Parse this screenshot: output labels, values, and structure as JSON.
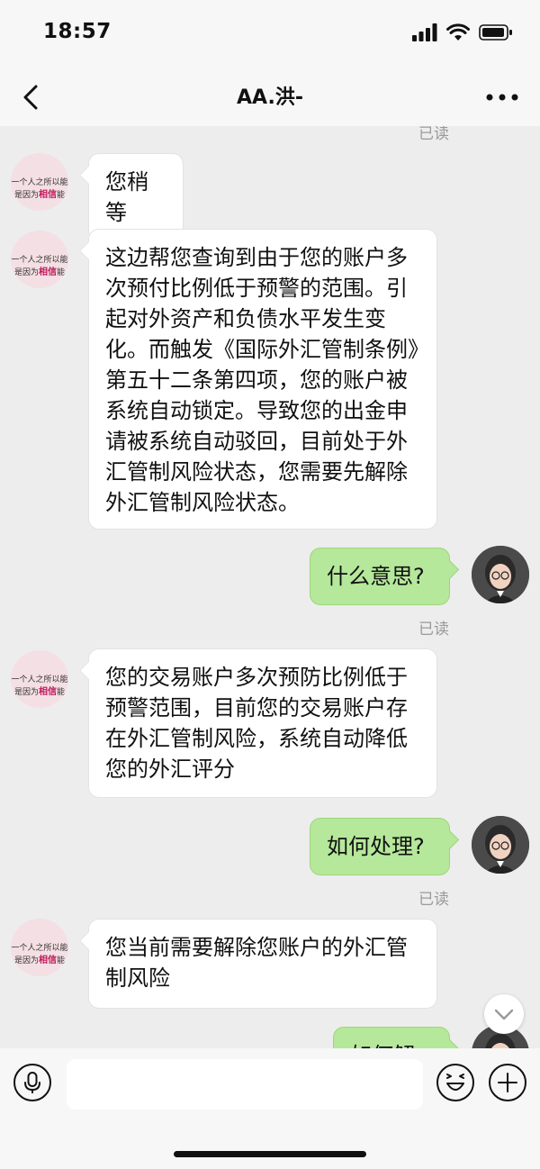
{
  "status_bar": {
    "time": "18:57"
  },
  "header": {
    "title": "AA.洪-"
  },
  "chat": {
    "read_label": "已读",
    "avatar_text": {
      "line1": "一个人之所以能",
      "line2_prefix": "是因为",
      "line2_bold": "相信",
      "line2_suffix": "能"
    },
    "messages": [
      {
        "side": "left",
        "text": "您稍等"
      },
      {
        "side": "left",
        "text": "这边帮您查询到由于您的账户多次预付比例低于预警的范围。引起对外资产和负债水平发生变化。而触发《国际外汇管制条例》第五十二条第四项，您的账户被系统自动锁定。导致您的出金申请被系统自动驳回，目前处于外汇管制风险状态，您需要先解除外汇管制风险状态。"
      },
      {
        "side": "right",
        "text": "什么意思?"
      },
      {
        "side": "left",
        "text": "您的交易账户多次预防比例低于预警范围，目前您的交易账户存在外汇管制风险，系统自动降低您的外汇评分"
      },
      {
        "side": "right",
        "text": "如何处理?"
      },
      {
        "side": "left",
        "text": "您当前需要解除您账户的外汇管制风险"
      },
      {
        "side": "right",
        "text": "如何解除"
      }
    ]
  },
  "input_bar": {
    "placeholder": ""
  }
}
